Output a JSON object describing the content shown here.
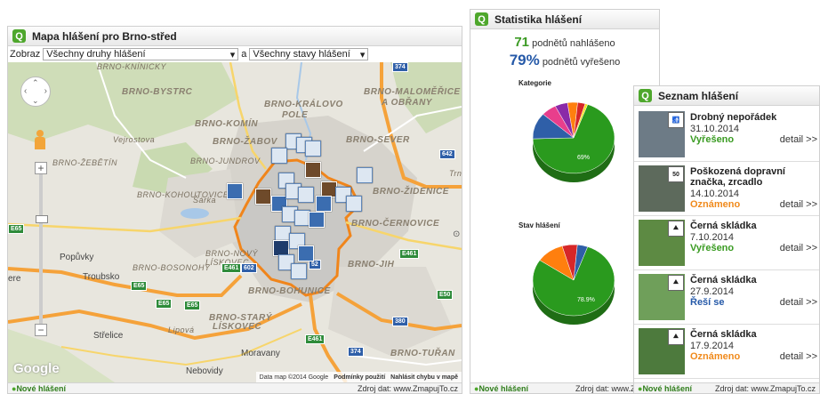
{
  "map_panel": {
    "title": "Mapa hlášení pro Brno-střed",
    "filter_label": "Zobraz",
    "type_select": "Všechny druhy hlášení",
    "conj": "a",
    "state_select": "Všechny stavy hlášení",
    "labels": {
      "bystrc": "BRNO-BYSTRC",
      "kralovo": "BRNO-KRÁLOVO",
      "pole": "POLE",
      "malomerice": "BRNO-MALOMĚŘICE",
      "obrany": "A OBŘANY",
      "komin": "BRNO-KOMÍN",
      "zabov": "BRNO-ŽABOV",
      "sever": "BRNO-SEVER",
      "zebetin": "BRNO-ŽEBĚTÍN",
      "jundrov": "BRNO-JUNDROV",
      "kohoutovice": "BRNO-KOHOUTOVICE",
      "zidenice": "BRNO-ŽIDENICE",
      "cernovice": "BRNO-ČERNOVICE",
      "novy": "BRNO-NOVÝ",
      "liskovec": "LÍSKOVEC",
      "bosonohy": "BRNO-BOSONOHY",
      "jih": "BRNO-JIH",
      "bohunice": "BRNO-BOHUNICE",
      "stary": "BRNO-STARÝ",
      "stary2": "LÍSKOVEC",
      "turan": "BRNO-TUŘAN",
      "vejrostova": "Vejrostova",
      "sarka": "Šárka",
      "kninicky": "BRNO-KNÍNICKY",
      "lipova": "Lipová",
      "trnkova": "Trnkov"
    },
    "towns": {
      "popuvky": "Popůvky",
      "troubsko": "Troubsko",
      "strelice": "Střelice",
      "nebovidy": "Nebovidy",
      "moravany": "Moravany",
      "ere": "ere"
    },
    "shields": [
      "374",
      "642",
      "E65",
      "E65",
      "E461",
      "602",
      "52",
      "E461",
      "E50",
      "E461",
      "380",
      "374",
      "E65",
      "E65"
    ],
    "attribution": "Data map ©2014 Google",
    "terms": "Podmínky použití",
    "report_error": "Nahlásit chybu v mapě",
    "google": "Google",
    "footer_link": "Nové hlášení",
    "footer_source": "Zdroj dat: www.ZmapujTo.cz"
  },
  "stats_panel": {
    "title": "Statistika hlášení",
    "count_num": "71",
    "count_text": "podnětů nahlášeno",
    "solved_num": "79%",
    "solved_text": "podnětů vyřešeno",
    "categories_title": "Kategorie",
    "states_title": "Stav hlášení",
    "footer_link": "Nové hlášení",
    "footer_source": "Zdroj dat: www.Zmapu"
  },
  "chart_data": [
    {
      "type": "pie",
      "title": "Kategorie",
      "label": "69%",
      "values": [
        69,
        12,
        6,
        5,
        4,
        3,
        1
      ],
      "colors": [
        "#2a9a1e",
        "#2f5fa8",
        "#e83e8c",
        "#8a2aa8",
        "#ff7f0e",
        "#d62728",
        "#f5e11a"
      ]
    },
    {
      "type": "pie",
      "title": "Stav hlášení",
      "label": "78.9%",
      "values": [
        78.9,
        11,
        6,
        4.1
      ],
      "colors": [
        "#2a9a1e",
        "#ff7f0e",
        "#d62728",
        "#2f5fa8"
      ]
    }
  ],
  "list_panel": {
    "title": "Seznam hlášení",
    "detail_label": "detail >>",
    "items": [
      {
        "title": "Drobný nepořádek",
        "date": "31.10.2014",
        "status": "Vyřešeno",
        "status_class": "st-green",
        "thumb": "#6d7b86",
        "badge": "🚮"
      },
      {
        "title": "Poškozená dopravní značka, zrcadlo",
        "date": "14.10.2014",
        "status": "Oznámeno",
        "status_class": "st-orange",
        "thumb": "#5d6a5c",
        "badge": "50"
      },
      {
        "title": "Černá skládka",
        "date": "7.10.2014",
        "status": "Vyřešeno",
        "status_class": "st-green",
        "thumb": "#5d8a43",
        "badge": "⛰"
      },
      {
        "title": "Černá skládka",
        "date": "27.9.2014",
        "status": "Řeší se",
        "status_class": "st-blue",
        "thumb": "#6f9f5a",
        "badge": "⛰"
      },
      {
        "title": "Černá skládka",
        "date": "17.9.2014",
        "status": "Oznámeno",
        "status_class": "st-orange",
        "thumb": "#4d7a3d",
        "badge": "⛰"
      }
    ],
    "footer_link": "Nové hlášení",
    "footer_source": "Zdroj dat: www.ZmapujTo.cz"
  }
}
